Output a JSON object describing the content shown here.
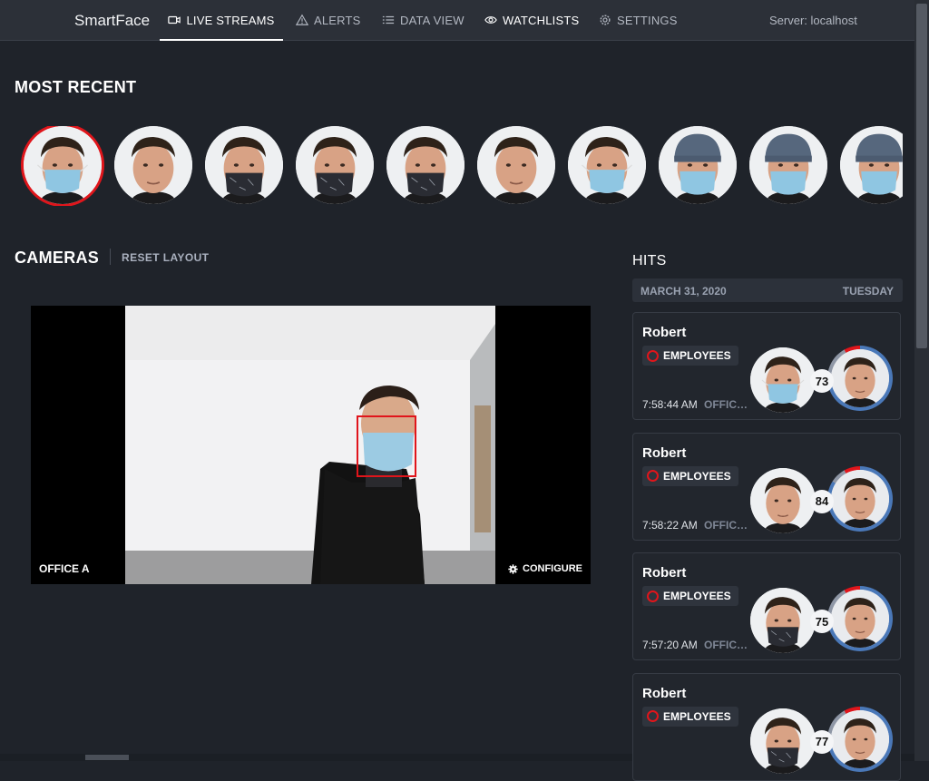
{
  "app": {
    "brand": "SmartFace",
    "server": "Server: localhost"
  },
  "nav": [
    {
      "label": "LIVE STREAMS",
      "icon": "video-camera-icon",
      "active": true
    },
    {
      "label": "ALERTS",
      "icon": "warning-icon",
      "active": false
    },
    {
      "label": "DATA VIEW",
      "icon": "list-icon",
      "active": false
    },
    {
      "label": "WATCHLISTS",
      "icon": "eye-icon",
      "active": false
    },
    {
      "label": "SETTINGS",
      "icon": "gear-icon",
      "active": false
    }
  ],
  "recent": {
    "title": "MOST RECENT",
    "faces": [
      {
        "variant": "mask",
        "selected": true
      },
      {
        "variant": "plain",
        "selected": false
      },
      {
        "variant": "scarf",
        "selected": false
      },
      {
        "variant": "scarf",
        "selected": false
      },
      {
        "variant": "scarf",
        "selected": false
      },
      {
        "variant": "plain",
        "selected": false
      },
      {
        "variant": "mask",
        "selected": false
      },
      {
        "variant": "beanie",
        "selected": false
      },
      {
        "variant": "beanie",
        "selected": false
      },
      {
        "variant": "beanie",
        "selected": false
      }
    ]
  },
  "cameras": {
    "title": "CAMERAS",
    "reset_label": "RESET LAYOUT",
    "stream": {
      "name": "OFFICE A",
      "configure_label": "CONFIGURE"
    }
  },
  "hits": {
    "title": "HITS",
    "date": "MARCH 31, 2020",
    "weekday": "TUESDAY",
    "items": [
      {
        "name": "Robert",
        "watchlist": "EMPLOYEES",
        "time": "7:58:44 AM",
        "camera": "OFFICE A",
        "score": "73",
        "variant": "mask",
        "color": "#e0151b"
      },
      {
        "name": "Robert",
        "watchlist": "EMPLOYEES",
        "time": "7:58:22 AM",
        "camera": "OFFICE A",
        "score": "84",
        "variant": "plain",
        "color": "#e0151b"
      },
      {
        "name": "Robert",
        "watchlist": "EMPLOYEES",
        "time": "7:57:20 AM",
        "camera": "OFFICE A",
        "score": "75",
        "variant": "scarf",
        "color": "#e0151b"
      },
      {
        "name": "Robert",
        "watchlist": "EMPLOYEES",
        "time": "",
        "camera": "",
        "score": "77",
        "variant": "scarf",
        "color": "#e0151b"
      }
    ]
  },
  "colors": {
    "accent": "#e0151b",
    "background": "#1f232a",
    "card": "#22262d",
    "ring_blue": "#4a78b8"
  }
}
